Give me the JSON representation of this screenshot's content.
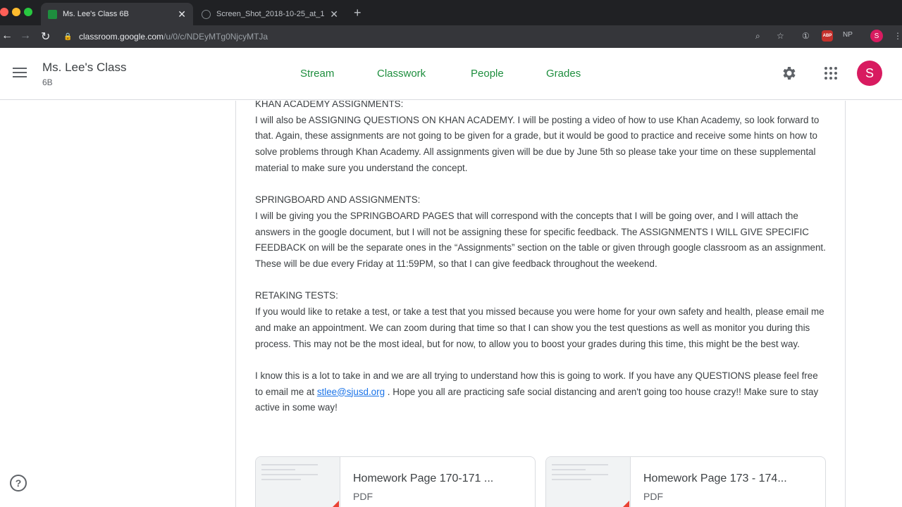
{
  "browser": {
    "tabs": [
      {
        "title": "Ms. Lee's Class 6B",
        "active": true
      },
      {
        "title": "Screen_Shot_2018-10-25_at_1",
        "active": false
      }
    ],
    "new_tab": "+",
    "close_glyph": "✕",
    "url_host": "classroom.google.com",
    "url_path": "/u/0/c/NDEyMTg0NjcyMTJa",
    "extensions": {
      "abp": "ABP",
      "np": "NP"
    },
    "profile_initial": "S"
  },
  "header": {
    "class_name": "Ms. Lee's Class",
    "section": "6B",
    "tabs": [
      "Stream",
      "Classwork",
      "People",
      "Grades"
    ],
    "active_tab": "Stream",
    "avatar_initial": "S",
    "accent_color": "#1e8e3e",
    "avatar_color": "#d81b60"
  },
  "post": {
    "partial_heading": "KHAN ACADEMY ASSIGNMENTS:",
    "khan_text": "I will also be ASSIGNING QUESTIONS ON KHAN ACADEMY. I will be posting a video of how to use Khan Academy, so look forward to that. Again, these assignments are not going to be given for a grade, but it would be good to practice and receive some hints on how to solve problems through Khan Academy. All assignments given will be due by June 5th so please take your time on these supplemental material to make sure you understand the concept.",
    "springboard_heading": "SPRINGBOARD AND ASSIGNMENTS:",
    "springboard_text": "I will be giving you the SPRINGBOARD PAGES that will correspond with the concepts that I will be going over, and I will attach the answers in the google document, but I will not be assigning these for specific feedback. The ASSIGNMENTS I WILL GIVE SPECIFIC FEEDBACK on will be the separate ones in the “Assignments” section on the table or given through google classroom as an assignment. These will be due every Friday at 11:59PM, so that I can give feedback throughout the weekend.",
    "retake_heading": "RETAKING TESTS:",
    "retake_text": "If you would like to retake a test, or take a test that you missed because you were home for your own safety and health, please email me and make an appointment. We can zoom during that time so that I can show you the test questions as well as monitor you during this process. This may not be the most ideal, but for now, to allow you to boost your grades during this time, this might be the best way.",
    "closing_before": "I know this is a lot to take in and we are all trying to understand how this is going to work. If you have any QUESTIONS please feel free to email me at ",
    "email": "stlee@sjusd.org",
    "closing_after": " . Hope you all are practicing safe social distancing and aren't going too house crazy!! Make sure to stay active in some way!"
  },
  "attachments": [
    {
      "title": "Homework Page 170-171 ...",
      "type": "PDF"
    },
    {
      "title": "Homework Page 173 - 174...",
      "type": "PDF"
    }
  ],
  "help_glyph": "?"
}
